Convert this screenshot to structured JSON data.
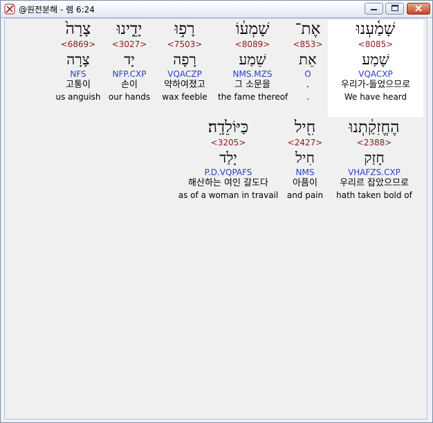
{
  "window": {
    "title": "@원전분해 - 렘 6:24",
    "icon": "cross-sword-icon",
    "controls": [
      "minimize-icon",
      "maximize-icon",
      "close-icon"
    ]
  },
  "rows": [
    {
      "words": [
        {
          "hebrew": "שָׁמַ֫עְנוּ",
          "strong": "<8085>",
          "lemma": "שָׁמַע",
          "parse": "VQACXP",
          "korean": "우리가-들었으므로",
          "english": "We have heard",
          "highlighted": true
        },
        {
          "hebrew": "אֶת־",
          "strong": "<853>",
          "lemma": "אֵת",
          "parse": "O",
          "korean": ".",
          "english": ".",
          "highlighted": false
        },
        {
          "hebrew": "שָׁמְע֔וֹ",
          "strong": "<8089>",
          "lemma": "שֵׁמַע",
          "parse": "NMS.MZS",
          "korean": "그 소문을",
          "english": "the fame thereof",
          "highlighted": false
        },
        {
          "hebrew": "רָפ֣וּ",
          "strong": "<7503>",
          "lemma": "רָפָה",
          "parse": "VQACZP",
          "korean": "약하여졌고",
          "english": "wax feeble",
          "highlighted": false
        },
        {
          "hebrew": "יָדֵ֑ינוּ",
          "strong": "<3027>",
          "lemma": "יָד",
          "parse": "NFP.CXP",
          "korean": "손이",
          "english": "our hands",
          "highlighted": false
        },
        {
          "hebrew": "צָרָה֙",
          "strong": "<6869>",
          "lemma": "צָרָה",
          "parse": "NFS",
          "korean": "고통이",
          "english": "us anguish",
          "highlighted": false
        }
      ]
    },
    {
      "words": [
        {
          "hebrew": "הֶחֱזִקַ֔תְנוּ",
          "strong": "<2388>",
          "lemma": "חָזַק",
          "parse": "VHAFZS.CXP",
          "korean": "우리르 잡았으므로",
          "english": "hath taken bold of",
          "highlighted": false
        },
        {
          "hebrew": "חִ֖יל",
          "strong": "<2427>",
          "lemma": "חִיל",
          "parse": "NMS",
          "korean": "아픔이",
          "english": "and pain",
          "highlighted": false
        },
        {
          "hebrew": "כַּיּוֹלֵדָֽה׃",
          "strong": "<3205>",
          "lemma": "יָלַד",
          "parse": "P.D.VQPAFS",
          "korean": "해산하는 여인 갈도다",
          "english": "as of a woman in travail",
          "highlighted": false
        }
      ]
    }
  ]
}
